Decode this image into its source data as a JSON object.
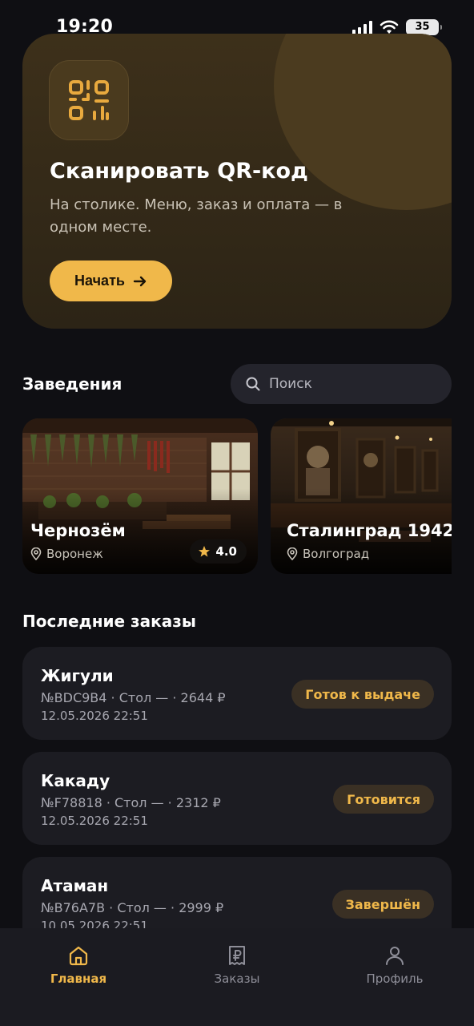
{
  "status_bar": {
    "time": "19:20",
    "battery": "35"
  },
  "hero": {
    "title": "Сканировать QR-код",
    "subtitle": "На столике. Меню, заказ и оплата — в одном месте.",
    "button_label": "Начать",
    "button_icon": "arrow-right-icon",
    "icon": "qr-code-icon"
  },
  "venues": {
    "title": "Заведения",
    "search_placeholder": "Поиск",
    "items": [
      {
        "name": "Чернозём",
        "city": "Воронеж",
        "rating": "4.0"
      },
      {
        "name": "Сталинград 1942",
        "city": "Волгоград"
      }
    ]
  },
  "orders": {
    "title": "Последние заказы",
    "items": [
      {
        "name": "Жигули",
        "meta": "№BDC9B4 · Стол — · 2644 ₽",
        "date": "12.05.2026 22:51",
        "status": "Готов к выдаче"
      },
      {
        "name": "Какаду",
        "meta": "№F78818 · Стол — · 2312 ₽",
        "date": "12.05.2026 22:51",
        "status": "Готовится"
      },
      {
        "name": "Атаман",
        "meta": "№B76A7B · Стол — · 2999 ₽",
        "date": "10.05.2026 22:51",
        "status": "Завершён"
      }
    ]
  },
  "tabs": [
    {
      "label": "Главная",
      "icon": "home-icon",
      "active": true
    },
    {
      "label": "Заказы",
      "icon": "receipt-ruble-icon",
      "active": false
    },
    {
      "label": "Профиль",
      "icon": "user-icon",
      "active": false
    }
  ],
  "colors": {
    "accent": "#f0b84a",
    "background": "#0f0f13",
    "card": "#1c1c22",
    "tab_bar": "#1b1b21"
  }
}
